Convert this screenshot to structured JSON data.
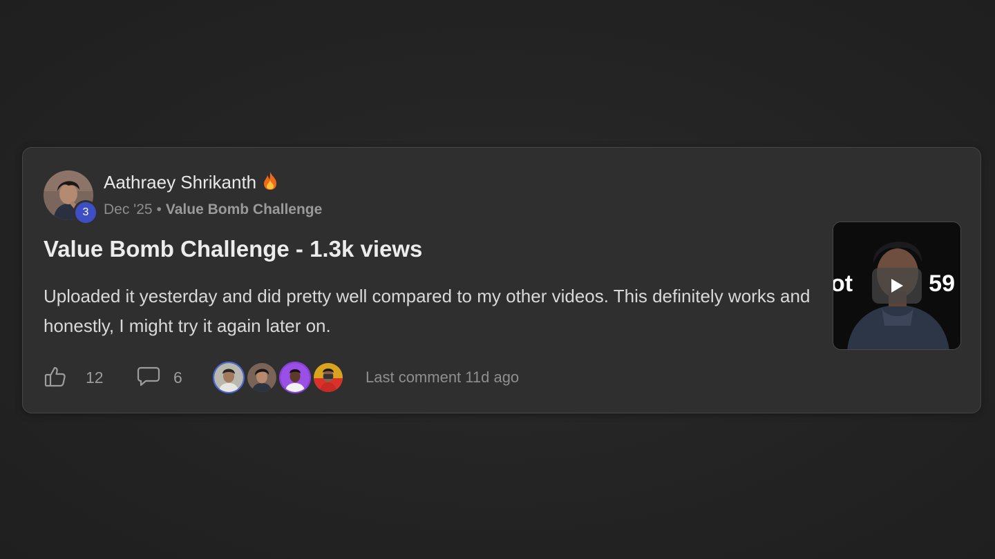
{
  "post": {
    "author": {
      "name": "Aathraey Shrikanth",
      "level": "3",
      "badge_icon": "fire-icon"
    },
    "date": "Dec '25",
    "separator": "•",
    "category": "Value Bomb Challenge",
    "title": "Value Bomb Challenge - 1.3k views",
    "body": "Uploaded it yesterday and did pretty well compared to my other videos. This definitely works and honestly, I might try it again later on.",
    "thumbnail": {
      "text_left": "ot",
      "text_right": "59",
      "overlay_icon": "play-icon"
    },
    "likes": "12",
    "comments": "6",
    "commenters": [
      {
        "name": "commenter-avatar-1",
        "border_color": "#4a67d6"
      },
      {
        "name": "commenter-avatar-2",
        "border_color": "#2f2f2f"
      },
      {
        "name": "commenter-avatar-3",
        "border_color": "#8d3fe0"
      },
      {
        "name": "commenter-avatar-4",
        "border_color": "#2f2f2f"
      }
    ],
    "last_comment": "Last comment 11d ago"
  },
  "colors": {
    "background": "#232323",
    "card": "#2f2f2f",
    "level_badge": "#3e4fc4",
    "fire": "#f06a1c"
  }
}
